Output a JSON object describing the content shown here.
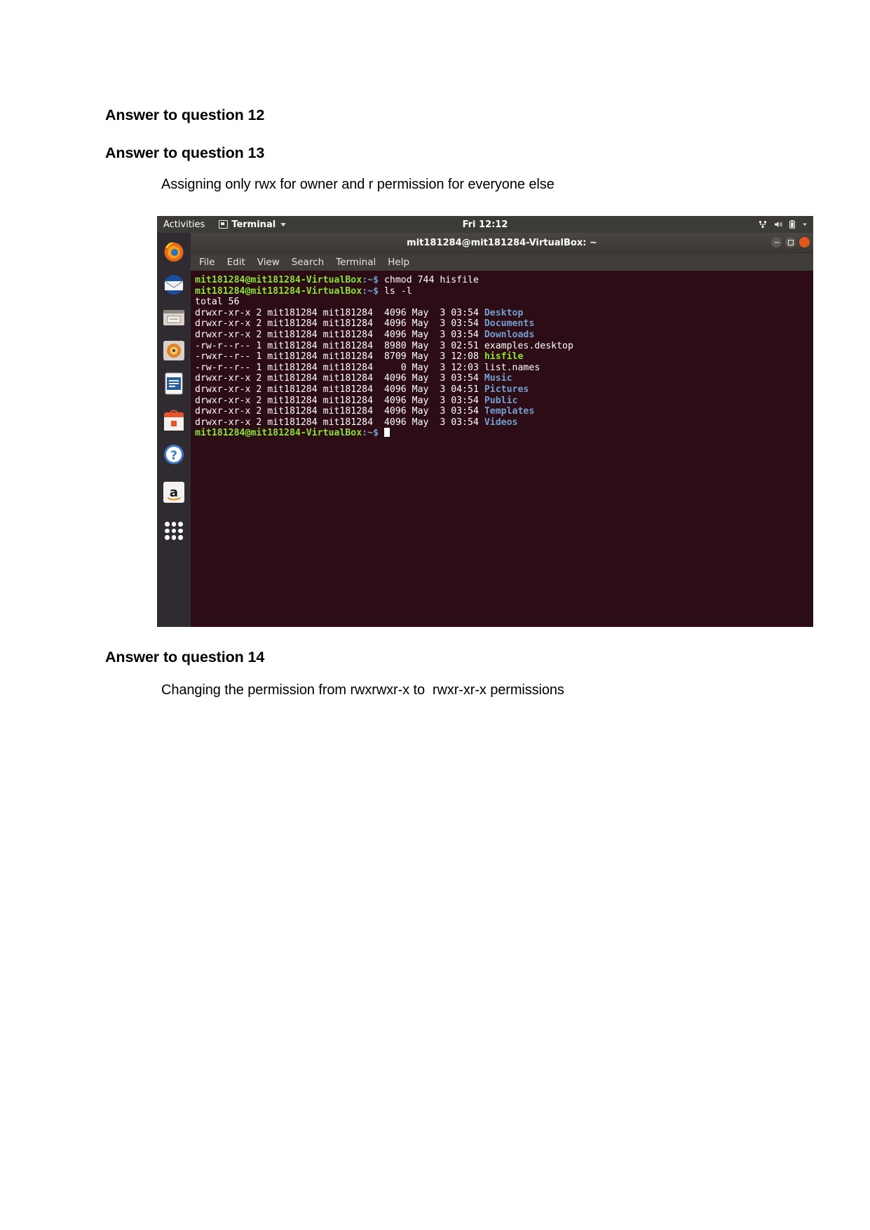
{
  "document": {
    "heading_12": "Answer to question 12",
    "heading_13": "Answer to question 13",
    "body_13": "Assigning only rwx for owner and r permission for everyone else",
    "heading_14": "Answer to question 14",
    "body_14": "Changing the permission from rwxrwxr-x to  rwxr-xr-x permissions"
  },
  "screenshot": {
    "gnome_bar": {
      "activities": "Activities",
      "app_name": "Terminal",
      "clock": "Fri 12:12",
      "status_icons": [
        "network-icon",
        "volume-icon",
        "battery-icon",
        "chevron-down-icon"
      ]
    },
    "dock": {
      "items": [
        "firefox-icon",
        "thunderbird-mail-icon",
        "files-nautilus-icon",
        "rhythmbox-icon",
        "libreoffice-writer-icon",
        "ubuntu-software-icon",
        "help-icon",
        "amazon-icon"
      ],
      "show_applications": "show-applications-grid-icon"
    },
    "terminal": {
      "window_title": "mit181284@mit181284-VirtualBox: ~",
      "window_controls": [
        "minimize-button",
        "maximize-button",
        "close-button"
      ],
      "menu": [
        "File",
        "Edit",
        "View",
        "Search",
        "Terminal",
        "Help"
      ],
      "prompt": "mit181284@mit181284-VirtualBox",
      "prompt_path": ":~$",
      "lines": [
        {
          "kind": "command",
          "command": " chmod 744 hisfile"
        },
        {
          "kind": "command",
          "command": " ls -l"
        },
        {
          "kind": "plain",
          "text": "total 56"
        },
        {
          "kind": "entry",
          "perms": "drwxr-xr-x",
          "links": "2",
          "owner": "mit181284",
          "group": "mit181284",
          "size": "4096",
          "month": "May",
          "day": "3",
          "time": "03:54",
          "name": "Desktop",
          "color": "dir"
        },
        {
          "kind": "entry",
          "perms": "drwxr-xr-x",
          "links": "2",
          "owner": "mit181284",
          "group": "mit181284",
          "size": "4096",
          "month": "May",
          "day": "3",
          "time": "03:54",
          "name": "Documents",
          "color": "dir"
        },
        {
          "kind": "entry",
          "perms": "drwxr-xr-x",
          "links": "2",
          "owner": "mit181284",
          "group": "mit181284",
          "size": "4096",
          "month": "May",
          "day": "3",
          "time": "03:54",
          "name": "Downloads",
          "color": "dir"
        },
        {
          "kind": "entry",
          "perms": "-rw-r--r--",
          "links": "1",
          "owner": "mit181284",
          "group": "mit181284",
          "size": "8980",
          "month": "May",
          "day": "3",
          "time": "02:51",
          "name": "examples.desktop",
          "color": "plain"
        },
        {
          "kind": "entry",
          "perms": "-rwxr--r--",
          "links": "1",
          "owner": "mit181284",
          "group": "mit181284",
          "size": "8709",
          "month": "May",
          "day": "3",
          "time": "12:08",
          "name": "hisfile",
          "color": "exe"
        },
        {
          "kind": "entry",
          "perms": "-rw-r--r--",
          "links": "1",
          "owner": "mit181284",
          "group": "mit181284",
          "size": "0",
          "month": "May",
          "day": "3",
          "time": "12:03",
          "name": "list.names",
          "color": "plain"
        },
        {
          "kind": "entry",
          "perms": "drwxr-xr-x",
          "links": "2",
          "owner": "mit181284",
          "group": "mit181284",
          "size": "4096",
          "month": "May",
          "day": "3",
          "time": "03:54",
          "name": "Music",
          "color": "dir"
        },
        {
          "kind": "entry",
          "perms": "drwxr-xr-x",
          "links": "2",
          "owner": "mit181284",
          "group": "mit181284",
          "size": "4096",
          "month": "May",
          "day": "3",
          "time": "04:51",
          "name": "Pictures",
          "color": "dir"
        },
        {
          "kind": "entry",
          "perms": "drwxr-xr-x",
          "links": "2",
          "owner": "mit181284",
          "group": "mit181284",
          "size": "4096",
          "month": "May",
          "day": "3",
          "time": "03:54",
          "name": "Public",
          "color": "dir"
        },
        {
          "kind": "entry",
          "perms": "drwxr-xr-x",
          "links": "2",
          "owner": "mit181284",
          "group": "mit181284",
          "size": "4096",
          "month": "May",
          "day": "3",
          "time": "03:54",
          "name": "Templates",
          "color": "dir"
        },
        {
          "kind": "entry",
          "perms": "drwxr-xr-x",
          "links": "2",
          "owner": "mit181284",
          "group": "mit181284",
          "size": "4096",
          "month": "May",
          "day": "3",
          "time": "03:54",
          "name": "Videos",
          "color": "dir"
        },
        {
          "kind": "prompt_only",
          "command": " "
        }
      ]
    },
    "colors": {
      "terminal_bg": "#2c0c15",
      "prompt_green": "#8ae234",
      "dir_blue": "#729fcf",
      "topbar": "#3c3b37",
      "dock": "#2f2b30",
      "close_orange": "#e2571e"
    }
  }
}
